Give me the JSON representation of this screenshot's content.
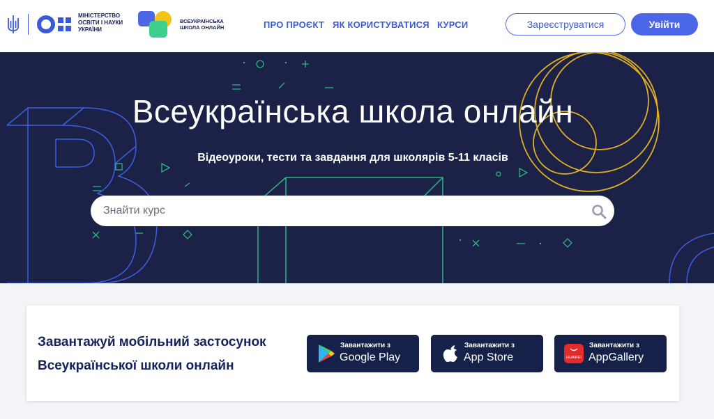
{
  "header": {
    "ministry_lines": [
      "Міністерство",
      "освіти і науки",
      "України"
    ],
    "school_lines": [
      "Всеукраїнська",
      "школа онлайн"
    ],
    "nav": [
      {
        "label": "ПРО ПРОЄКТ"
      },
      {
        "label": "ЯК КОРИСТУВАТИСЯ"
      },
      {
        "label": "КУРСИ"
      }
    ],
    "register_label": "Зареєструватися",
    "login_label": "Увійти"
  },
  "hero": {
    "title": "Всеукраїнська школа онлайн",
    "subtitle": "Відеоуроки, тести та завдання для школярів 5-11 класів",
    "search_placeholder": "Знайти курс"
  },
  "app_section": {
    "lines": [
      "Завантажуй мобільний застосунок",
      "Всеукраїнської школи онлайн"
    ],
    "stores": [
      {
        "small": "Завантажити з",
        "big": "Google Play",
        "icon": "google-play-icon"
      },
      {
        "small": "Завантажити з",
        "big": "App Store",
        "icon": "apple-icon"
      },
      {
        "small": "Завантажити з",
        "big": "AppGallery",
        "icon": "huawei-appgallery-icon",
        "icon_label": "HUAWEI"
      }
    ]
  },
  "colors": {
    "brand_blue": "#4b66e6",
    "navy": "#1b2147",
    "store_button": "#16214a",
    "accent_yellow": "#e0b020",
    "accent_green": "#3ecf8e"
  }
}
